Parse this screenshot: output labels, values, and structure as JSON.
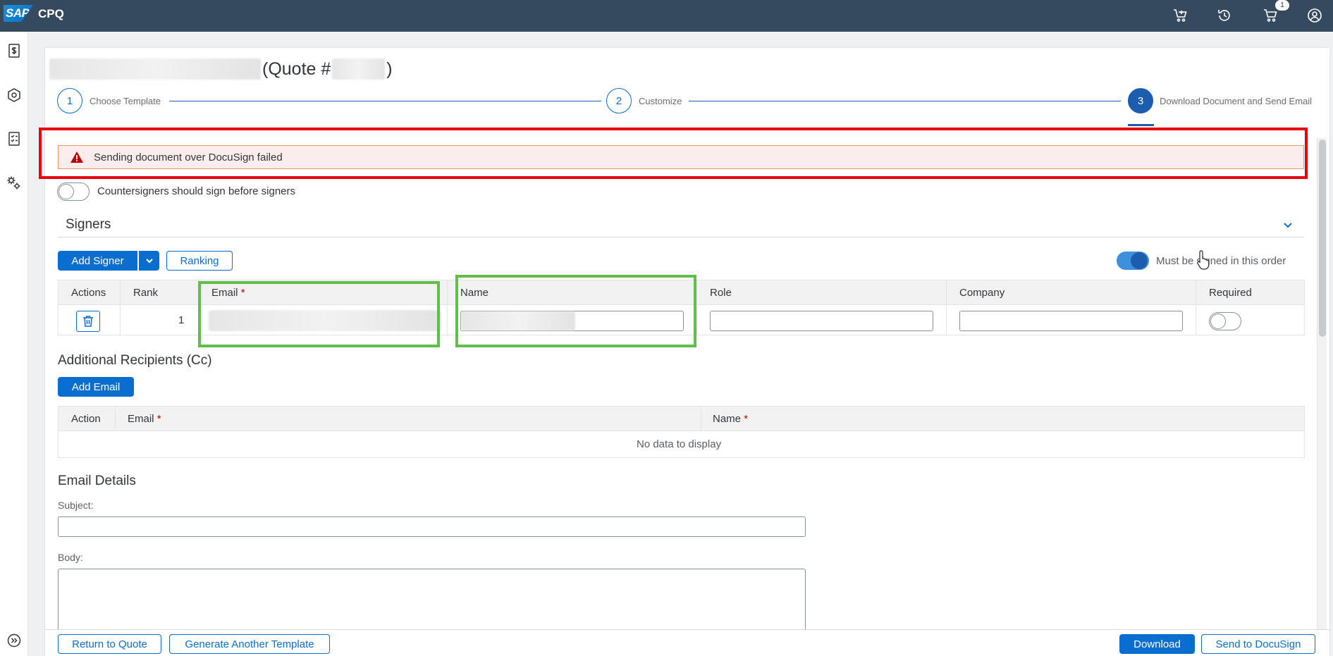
{
  "shell": {
    "logo": "SAP",
    "app_name": "CPQ",
    "cart_count": "1"
  },
  "page": {
    "title": "(Quote #"
  },
  "stepper": {
    "steps": [
      {
        "number": "1",
        "label": "Choose Template"
      },
      {
        "number": "2",
        "label": "Customize"
      },
      {
        "number": "3",
        "label": "Download Document and Send Email"
      }
    ]
  },
  "error_message": "Sending document over DocuSign failed",
  "countersign_toggle_label": "Countersigners should sign before signers",
  "signers": {
    "section_title": "Signers",
    "add_signer_label": "Add Signer",
    "ranking_label": "Ranking",
    "order_toggle_label": "Must be signed in this order",
    "columns": {
      "actions": "Actions",
      "rank": "Rank",
      "email": "Email",
      "name": "Name",
      "role": "Role",
      "company": "Company",
      "required": "Required"
    },
    "rows": [
      {
        "rank": "1"
      }
    ]
  },
  "recipients": {
    "section_title": "Additional Recipients (Cc)",
    "add_email_label": "Add Email",
    "columns": {
      "action": "Action",
      "email": "Email",
      "name": "Name"
    },
    "empty_text": "No data to display"
  },
  "email_details": {
    "section_title": "Email Details",
    "subject_label": "Subject:",
    "body_label": "Body:"
  },
  "required_marker": "*",
  "footer": {
    "return_label": "Return to Quote",
    "generate_label": "Generate Another Template",
    "download_label": "Download",
    "send_label": "Send to DocuSign"
  }
}
